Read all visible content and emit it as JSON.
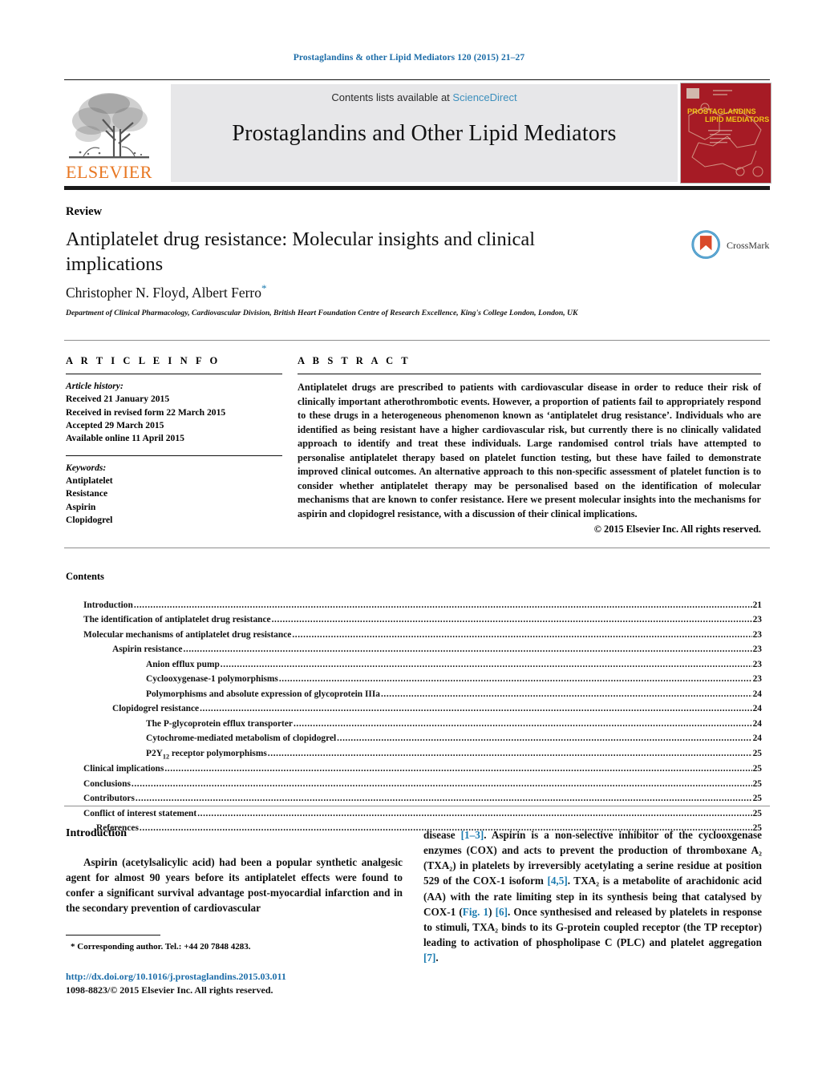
{
  "running_head": "Prostaglandins & other Lipid Mediators 120 (2015) 21–27",
  "masthead": {
    "contents_prefix": "Contents lists available at ",
    "sciencedirect": "ScienceDirect",
    "journal_name": "Prostaglandins and Other Lipid Mediators",
    "publisher": "ELSEVIER",
    "cover_title_line1": "PROSTAGLANDINS",
    "cover_title_line2": "LIPID MEDIATORS"
  },
  "article": {
    "type": "Review",
    "title": "Antiplatelet drug resistance: Molecular insights and clinical implications",
    "authors": "Christopher N. Floyd, Albert Ferro",
    "corresponding_marker": "*",
    "affiliation": "Department of Clinical Pharmacology, Cardiovascular Division, British Heart Foundation Centre of Research Excellence, King's College London, London, UK",
    "crossmark_label": "CrossMark"
  },
  "info": {
    "heading": "A R T I C L E    I N F O",
    "history_label": "Article history:",
    "history": [
      "Received 21 January 2015",
      "Received in revised form 22 March 2015",
      "Accepted 29 March 2015",
      "Available online 11 April 2015"
    ],
    "keywords_label": "Keywords:",
    "keywords": [
      "Antiplatelet",
      "Resistance",
      "Aspirin",
      "Clopidogrel"
    ]
  },
  "abstract": {
    "heading": "A B S T R A C T",
    "text": "Antiplatelet drugs are prescribed to patients with cardiovascular disease in order to reduce their risk of clinically important atherothrombotic events. However, a proportion of patients fail to appropriately respond to these drugs in a heterogeneous phenomenon known as ‘antiplatelet drug resistance’. Individuals who are identified as being resistant have a higher cardiovascular risk, but currently there is no clinically validated approach to identify and treat these individuals. Large randomised control trials have attempted to personalise antiplatelet therapy based on platelet function testing, but these have failed to demonstrate improved clinical outcomes. An alternative approach to this non-specific assessment of platelet function is to consider whether antiplatelet therapy may be personalised based on the identification of molecular mechanisms that are known to confer resistance. Here we present molecular insights into the mechanisms for aspirin and clopidogrel resistance, with a discussion of their clinical implications.",
    "copyright": "© 2015 Elsevier Inc. All rights reserved."
  },
  "contents": {
    "heading": "Contents",
    "items": [
      {
        "label": "Introduction",
        "page": "21",
        "level": 0
      },
      {
        "label": "The identification of antiplatelet drug resistance",
        "page": "23",
        "level": 0
      },
      {
        "label": "Molecular mechanisms of antiplatelet drug resistance",
        "page": "23",
        "level": 0
      },
      {
        "label": "Aspirin resistance",
        "page": "23",
        "level": 1
      },
      {
        "label": "Anion efflux pump",
        "page": "23",
        "level": 2
      },
      {
        "label": "Cyclooxygenase-1 polymorphisms",
        "page": "23",
        "level": 2
      },
      {
        "label": "Polymorphisms and absolute expression of glycoprotein IIIa",
        "page": "24",
        "level": 2
      },
      {
        "label": "Clopidogrel resistance",
        "page": "24",
        "level": 1
      },
      {
        "label": "The P-glycoprotein efflux transporter",
        "page": "24",
        "level": 2
      },
      {
        "label": "Cytochrome-mediated metabolism of clopidogrel",
        "page": "24",
        "level": 2
      },
      {
        "label": "P2Y12 receptor polymorphisms",
        "page": "25",
        "level": 2,
        "subscript": "12",
        "label_prefix": "P2Y",
        "label_suffix": " receptor polymorphisms"
      },
      {
        "label": "Clinical implications",
        "page": "25",
        "level": 0
      },
      {
        "label": "Conclusions",
        "page": "25",
        "level": 0
      },
      {
        "label": "Contributors",
        "page": "25",
        "level": 0
      },
      {
        "label": "Conflict of interest statement",
        "page": "25",
        "level": 0
      },
      {
        "label": "References",
        "page": "25",
        "level": 3
      }
    ]
  },
  "body": {
    "intro_heading": "Introduction",
    "left_paragraph": "Aspirin (acetylsalicylic acid) had been a popular synthetic analgesic agent for almost 90 years before its antiplatelet effects were found to confer a significant survival advantage post-myocardial infarction and in the secondary prevention of cardiovascular",
    "right_paragraph_parts": [
      {
        "t": "disease "
      },
      {
        "t": "[1–3]",
        "ref": true
      },
      {
        "t": ". Aspirin is a non-selective inhibitor of the cyclooxgenase enzymes (COX) and acts to prevent the production of thromboxane A₂ (TXA₂) in platelets by irreversibly acetylating a serine residue at position 529 of the COX-1 isoform "
      },
      {
        "t": "[4,5]",
        "ref": true
      },
      {
        "t": ". TXA₂ is a metabolite of arachidonic acid (AA) with the rate limiting step in its synthesis being that catalysed by COX-1 ("
      },
      {
        "t": "Fig. 1",
        "ref": true
      },
      {
        "t": ") "
      },
      {
        "t": "[6]",
        "ref": true
      },
      {
        "t": ". Once synthesised and released by platelets in response to stimuli, TXA₂ binds to its G-protein coupled receptor (the TP receptor) leading to activation of phospholipase C (PLC) and platelet aggregation "
      },
      {
        "t": "[7]",
        "ref": true
      },
      {
        "t": "."
      }
    ]
  },
  "footer": {
    "footnote": "* Corresponding author. Tel.: +44 20 7848 4283.",
    "doi": "http://dx.doi.org/10.1016/j.prostaglandins.2015.03.011",
    "issn": "1098-8823/© 2015 Elsevier Inc. All rights reserved."
  },
  "colors": {
    "link_blue": "#1b6ca8",
    "sciencedirect_blue": "#3c8fbd",
    "elsevier_orange": "#e87722",
    "cover_red": "#a61b25",
    "reference_blue": "#1b7bb0"
  }
}
